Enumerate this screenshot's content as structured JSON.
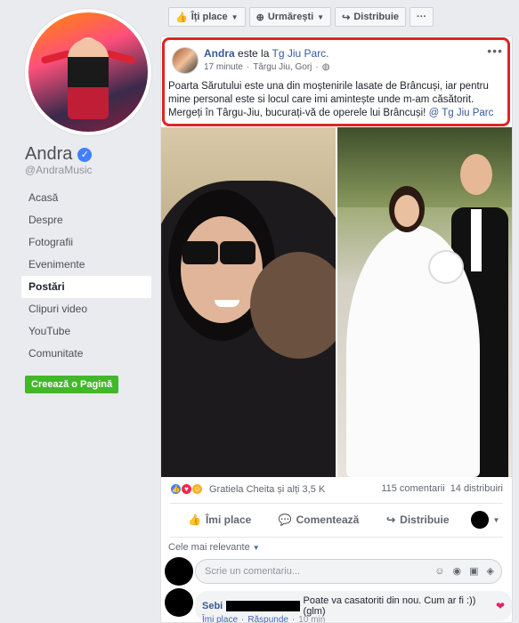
{
  "sidebar": {
    "page_name": "Andra",
    "handle": "@AndraMusic",
    "items": [
      {
        "label": "Acasă"
      },
      {
        "label": "Despre"
      },
      {
        "label": "Fotografii"
      },
      {
        "label": "Evenimente"
      },
      {
        "label": "Postări"
      },
      {
        "label": "Clipuri video"
      },
      {
        "label": "YouTube"
      },
      {
        "label": "Comunitate"
      }
    ],
    "active_item": "Postări",
    "create_page_label": "Creează o Pagină"
  },
  "topbar": {
    "like_label": "Îți place",
    "follow_label": "Urmărești",
    "share_label": "Distribuie",
    "more_label": "···"
  },
  "post": {
    "author": "Andra",
    "is_at": "este la",
    "location": "Tg Jiu Parc.",
    "time": "17 minute",
    "place": "Târgu Jiu, Gorj",
    "text_main": "Poarta Sărutului este una din moștenirile lasate de Brâncuși, iar pentru mine personal este si locul care imi amintește unde m-am căsătorit. Mergeți în Târgu-Jiu, bucurați-vă de operele lui Brâncuși!",
    "text_tag": "@ Tg Jiu Parc",
    "reactions_text": "Gratiela Cheita și alți 3,5 K",
    "comments_count": "115 comentarii",
    "shares_count": "14 distribuiri",
    "action_like": "Îmi place",
    "action_comment": "Comentează",
    "action_share": "Distribuie"
  },
  "comments": {
    "sort_label": "Cele mai relevante",
    "input_placeholder": "Scrie un comentariu...",
    "first": {
      "name": "Sebi",
      "text": "Poate va casatoriti din nou. Cum ar fi :)) (glm)",
      "like_link": "Îmi place",
      "reply_link": "Răspunde",
      "time": "10 min"
    }
  },
  "colors": {
    "brand_blue": "#4267b2",
    "link_blue": "#365899",
    "create_green": "#42b72a",
    "highlight_red": "#e02424"
  }
}
